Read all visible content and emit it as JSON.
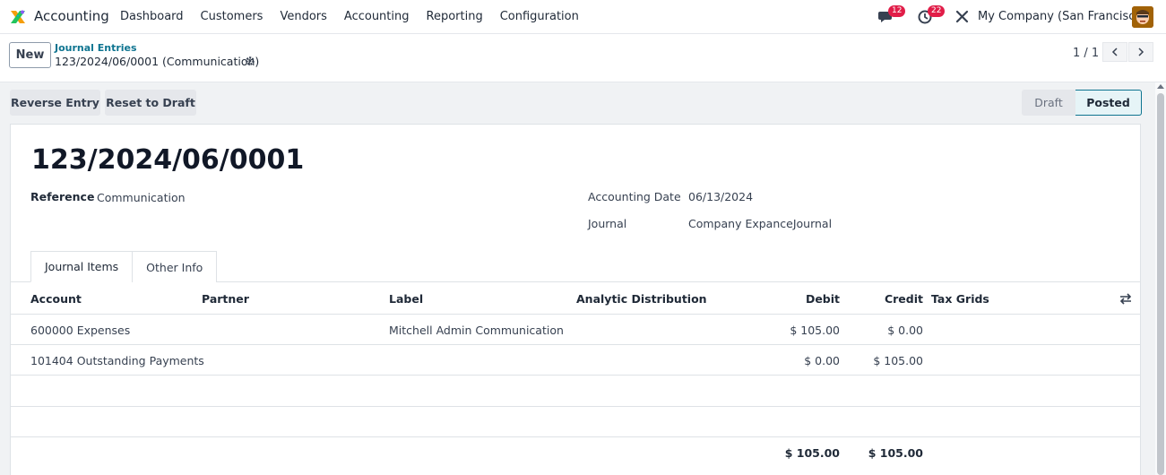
{
  "navbar": {
    "app_name": "Accounting",
    "menu": [
      "Dashboard",
      "Customers",
      "Vendors",
      "Accounting",
      "Reporting",
      "Configuration"
    ],
    "messages_count": "12",
    "activities_count": "22",
    "company": "My Company (San Francisco)"
  },
  "control": {
    "new_label": "New",
    "breadcrumb_parent": "Journal Entries",
    "breadcrumb_current": "123/2024/06/0001 (Communication)",
    "pager": "1 / 1"
  },
  "actions": {
    "reverse": "Reverse Entry",
    "reset": "Reset to Draft"
  },
  "status": {
    "draft": "Draft",
    "posted": "Posted"
  },
  "form": {
    "title": "123/2024/06/0001",
    "reference_label": "Reference",
    "reference_value": "Communication",
    "accounting_date_label": "Accounting Date",
    "accounting_date_value": "06/13/2024",
    "journal_label": "Journal",
    "journal_value": "Company ExpanceJournal"
  },
  "tabs": [
    "Journal Items",
    "Other Info"
  ],
  "table": {
    "headers": {
      "account": "Account",
      "partner": "Partner",
      "label": "Label",
      "analytic": "Analytic Distribution",
      "debit": "Debit",
      "credit": "Credit",
      "tax_grids": "Tax Grids"
    },
    "rows": [
      {
        "account": "600000 Expenses",
        "partner": "",
        "label": "Mitchell Admin Communication",
        "debit": "$ 105.00",
        "credit": "$ 0.00"
      },
      {
        "account": "101404 Outstanding Payments",
        "partner": "",
        "label": "",
        "debit": "$ 0.00",
        "credit": "$ 105.00"
      }
    ],
    "total_debit": "$ 105.00",
    "total_credit": "$ 105.00"
  },
  "colors": {
    "accent": "#0e7490",
    "badge": "#e11d48"
  }
}
